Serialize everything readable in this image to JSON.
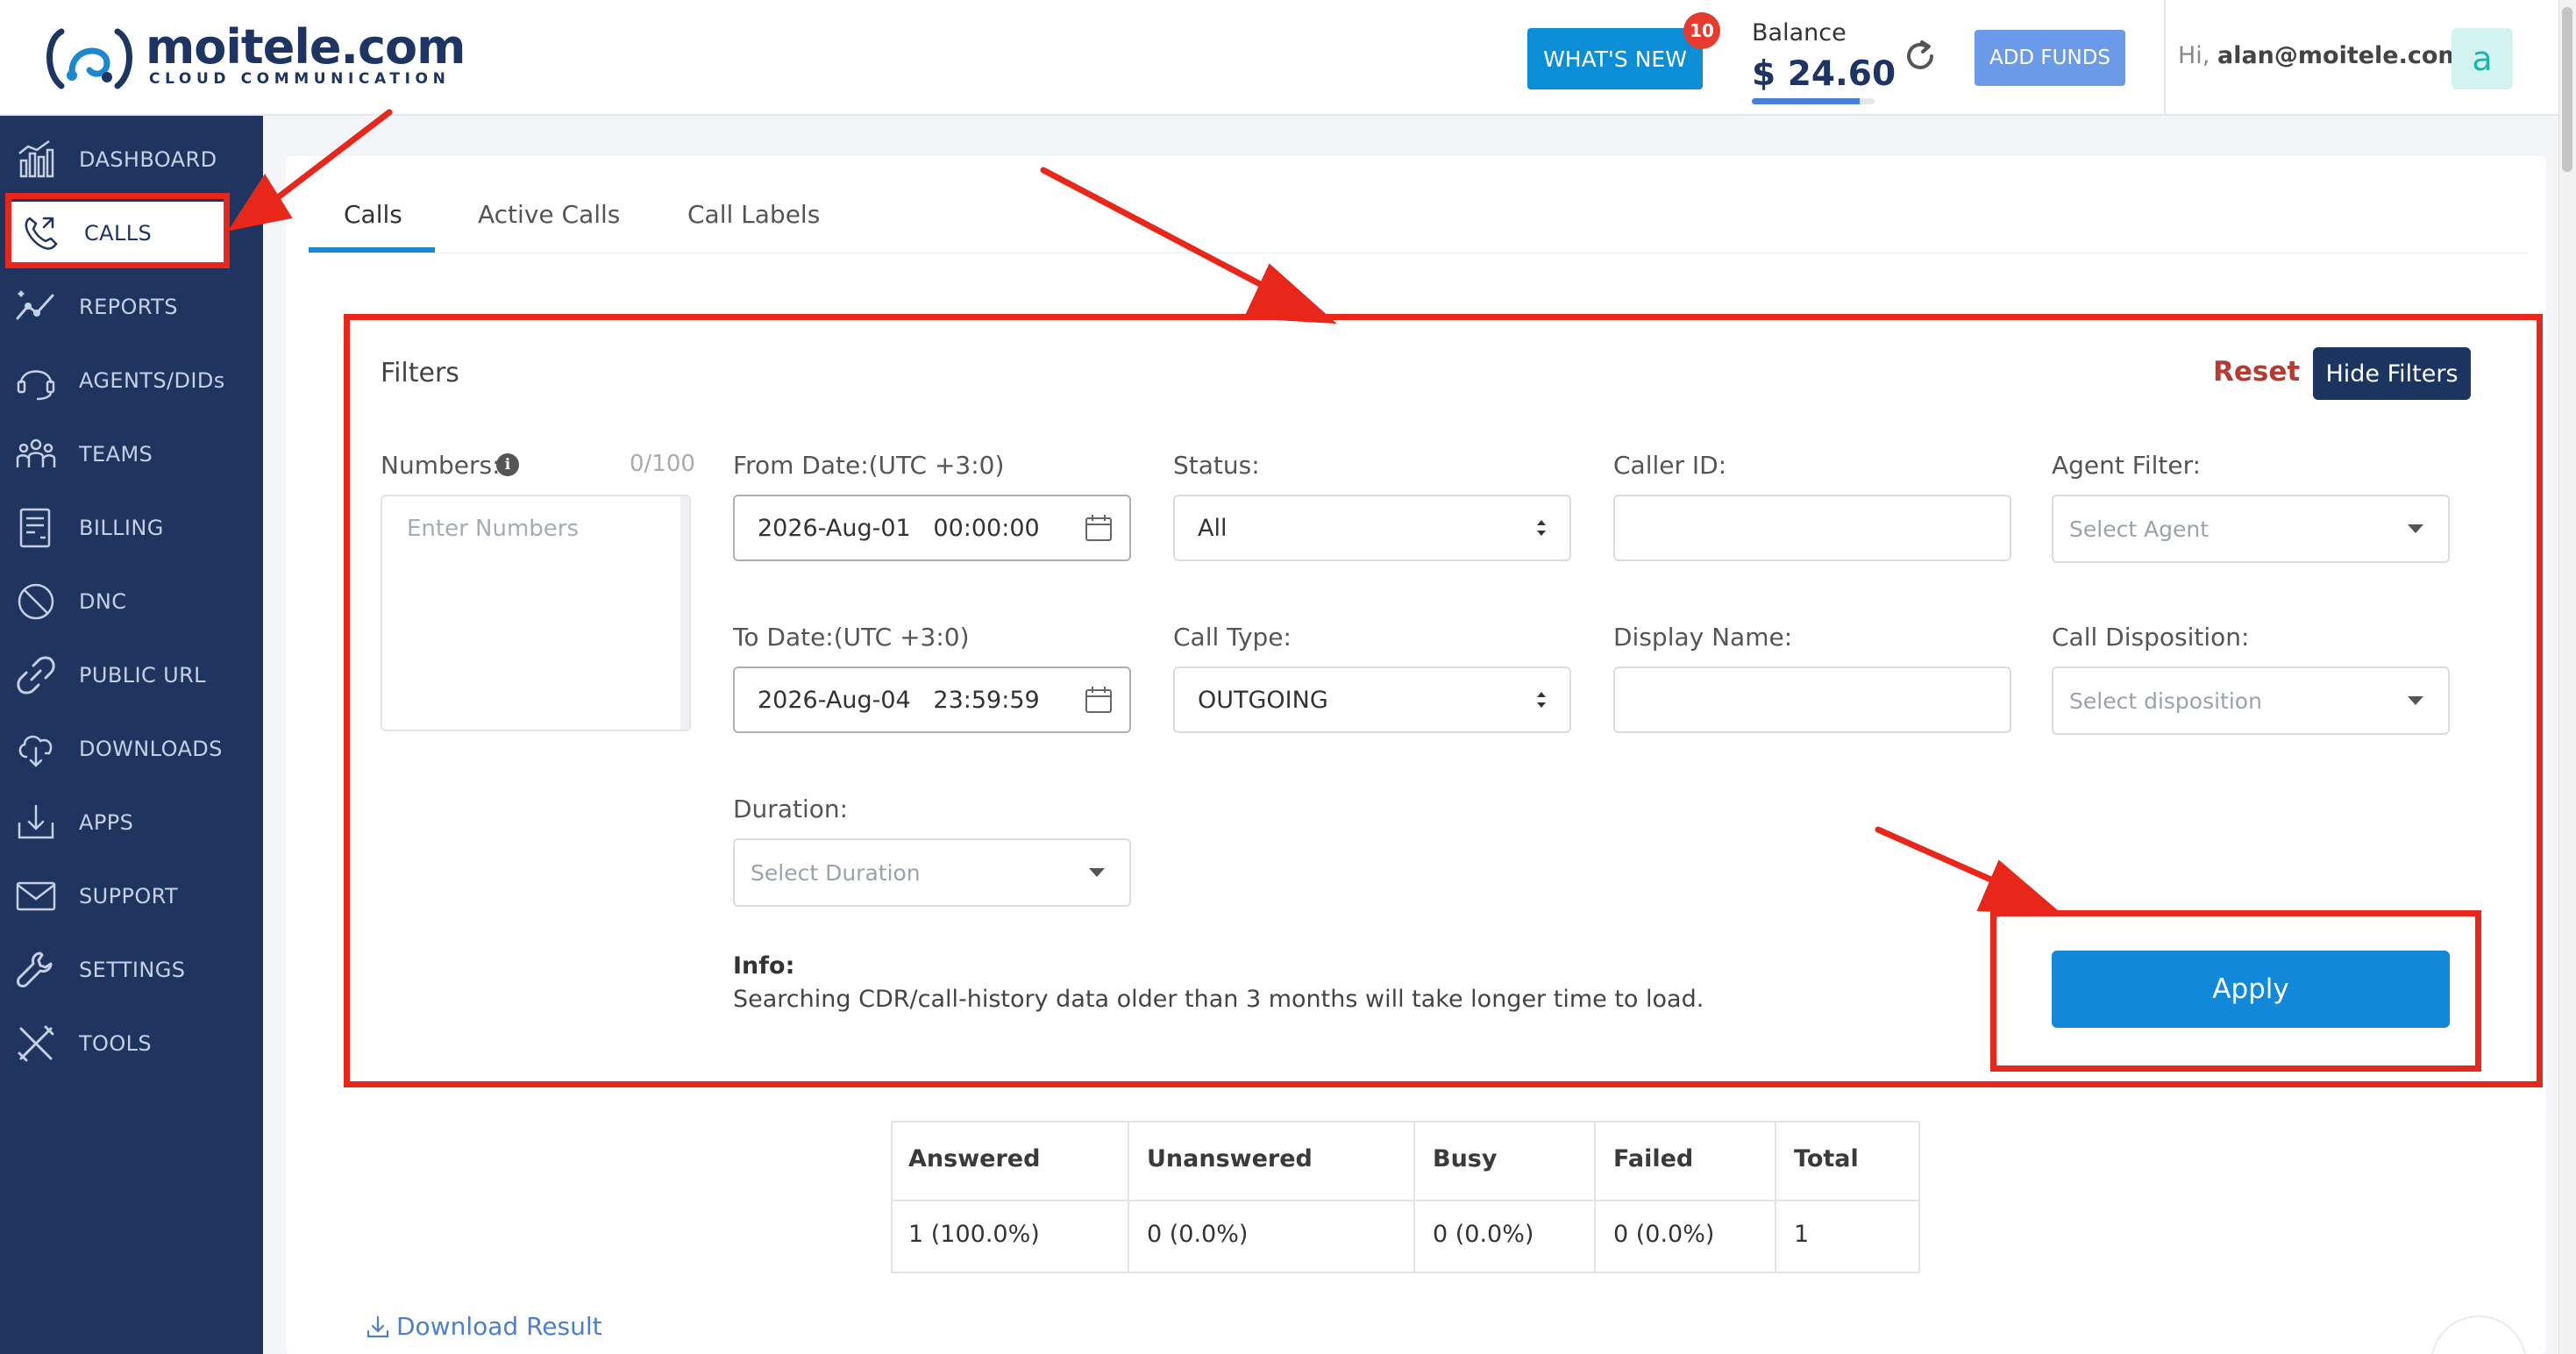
{
  "header": {
    "logo": {
      "name": "moitele.com",
      "tagline": "CLOUD COMMUNICATION"
    },
    "whats_new": {
      "label": "WHAT'S NEW",
      "badge": "10"
    },
    "balance": {
      "label": "Balance",
      "value": "$ 24.60",
      "bar_fraction": 0.88
    },
    "add_funds_label": "ADD FUNDS",
    "greeting_prefix": "Hi,",
    "user_email": "alan@moitele.com",
    "avatar_letter": "a"
  },
  "sidebar": {
    "items": [
      {
        "label": "DASHBOARD",
        "icon": "dashboard-icon"
      },
      {
        "label": "CALLS",
        "icon": "calls-icon",
        "active": true
      },
      {
        "label": "REPORTS",
        "icon": "reports-icon"
      },
      {
        "label": "AGENTS/DIDs",
        "icon": "headset-icon"
      },
      {
        "label": "TEAMS",
        "icon": "teams-icon"
      },
      {
        "label": "BILLING",
        "icon": "billing-icon"
      },
      {
        "label": "DNC",
        "icon": "block-icon"
      },
      {
        "label": "PUBLIC URL",
        "icon": "link-icon"
      },
      {
        "label": "DOWNLOADS",
        "icon": "cloud-download-icon"
      },
      {
        "label": "APPS",
        "icon": "apps-icon"
      },
      {
        "label": "SUPPORT",
        "icon": "mail-icon"
      },
      {
        "label": "SETTINGS",
        "icon": "wrench-icon"
      },
      {
        "label": "TOOLS",
        "icon": "tools-icon"
      }
    ]
  },
  "tabs": [
    {
      "label": "Calls",
      "active": true
    },
    {
      "label": "Active Calls"
    },
    {
      "label": "Call Labels"
    }
  ],
  "filters": {
    "title": "Filters",
    "reset_label": "Reset",
    "hide_label": "Hide Filters",
    "numbers": {
      "label": "Numbers:",
      "counter": "0/100",
      "placeholder": "Enter Numbers"
    },
    "from_date": {
      "label": "From Date:(UTC +3:0)",
      "value": "2026-Aug-01   00:00:00"
    },
    "to_date": {
      "label": "To Date:(UTC +3:0)",
      "value": "2026-Aug-04   23:59:59"
    },
    "status": {
      "label": "Status:",
      "value": "All"
    },
    "call_type": {
      "label": "Call Type:",
      "value": "OUTGOING"
    },
    "caller_id": {
      "label": "Caller ID:",
      "value": ""
    },
    "display_name": {
      "label": "Display Name:",
      "value": ""
    },
    "agent_filter": {
      "label": "Agent Filter:",
      "placeholder": "Select Agent"
    },
    "call_disposition": {
      "label": "Call Disposition:",
      "placeholder": "Select disposition"
    },
    "duration": {
      "label": "Duration:",
      "placeholder": "Select Duration"
    },
    "info_title": "Info:",
    "info_text": "Searching CDR/call-history data older than 3 months will take longer time to load.",
    "apply_label": "Apply"
  },
  "summary": {
    "headers": [
      "Answered",
      "Unanswered",
      "Busy",
      "Failed",
      "Total"
    ],
    "values": [
      "1 (100.0%)",
      "0 (0.0%)",
      "0 (0.0%)",
      "0 (0.0%)",
      "1"
    ]
  },
  "download_label": "Download Result",
  "colors": {
    "sidebar": "#1f3560",
    "accent": "#1188d8",
    "annotation": "#e8271a"
  }
}
